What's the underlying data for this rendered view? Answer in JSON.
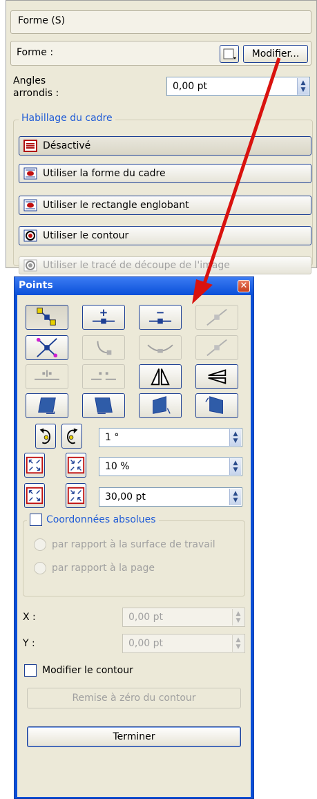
{
  "shape_panel": {
    "header": "Forme (S)",
    "shape_label": "Forme :",
    "modify_button": "Modifier...",
    "rounded_label_line1": "Angles",
    "rounded_label_line2": "arrondis :",
    "rounded_value": "0,00 pt",
    "wrap_group_title": "Habillage du cadre",
    "wrap_options": [
      {
        "label": "Désactivé",
        "state": "active"
      },
      {
        "label": "Utiliser la forme du cadre",
        "state": "normal"
      },
      {
        "label": "Utiliser le rectangle englobant",
        "state": "normal"
      },
      {
        "label": "Utiliser le contour",
        "state": "normal"
      },
      {
        "label": "Utiliser le tracé de découpe de l'image",
        "state": "disabled"
      }
    ]
  },
  "annotation": {
    "arrow_color": "#d9120e"
  },
  "points_window": {
    "title": "Points",
    "close_glyph": "✕",
    "tool_icons": [
      [
        "move-points-icon",
        "add-point-icon",
        "delete-point-icon",
        "make-corner-icon"
      ],
      [
        "move-control-icon",
        "reset-control-icon",
        "symmetric-control-icon",
        "asymmetric-control-icon"
      ],
      [
        "disconnect-icon",
        "connect-icon",
        "flip-horizontal-icon",
        "flip-vertical-icon"
      ],
      [
        "shear-left-icon",
        "shear-right-icon",
        "shear-up-icon",
        "shear-down-icon"
      ]
    ],
    "rotation_value": "1 °",
    "scale_value": "10 %",
    "size_value": "30,00 pt",
    "abs_coords_label": "Coordonnées absolues",
    "radio_workspace": "par rapport à la surface de travail",
    "radio_page": "par rapport à la page",
    "x_label": "X :",
    "x_value": "0,00 pt",
    "y_label": "Y :",
    "y_value": "0,00 pt",
    "edit_contour_label": "Modifier le contour",
    "reset_contour_button": "Remise à zéro du contour",
    "finish_button": "Terminer"
  },
  "colors": {
    "accent_blue": "#1f5bd6",
    "window_blue": "#0a4fd8",
    "panel_bg": "#ece9d8",
    "arrow_red": "#d9120e"
  }
}
